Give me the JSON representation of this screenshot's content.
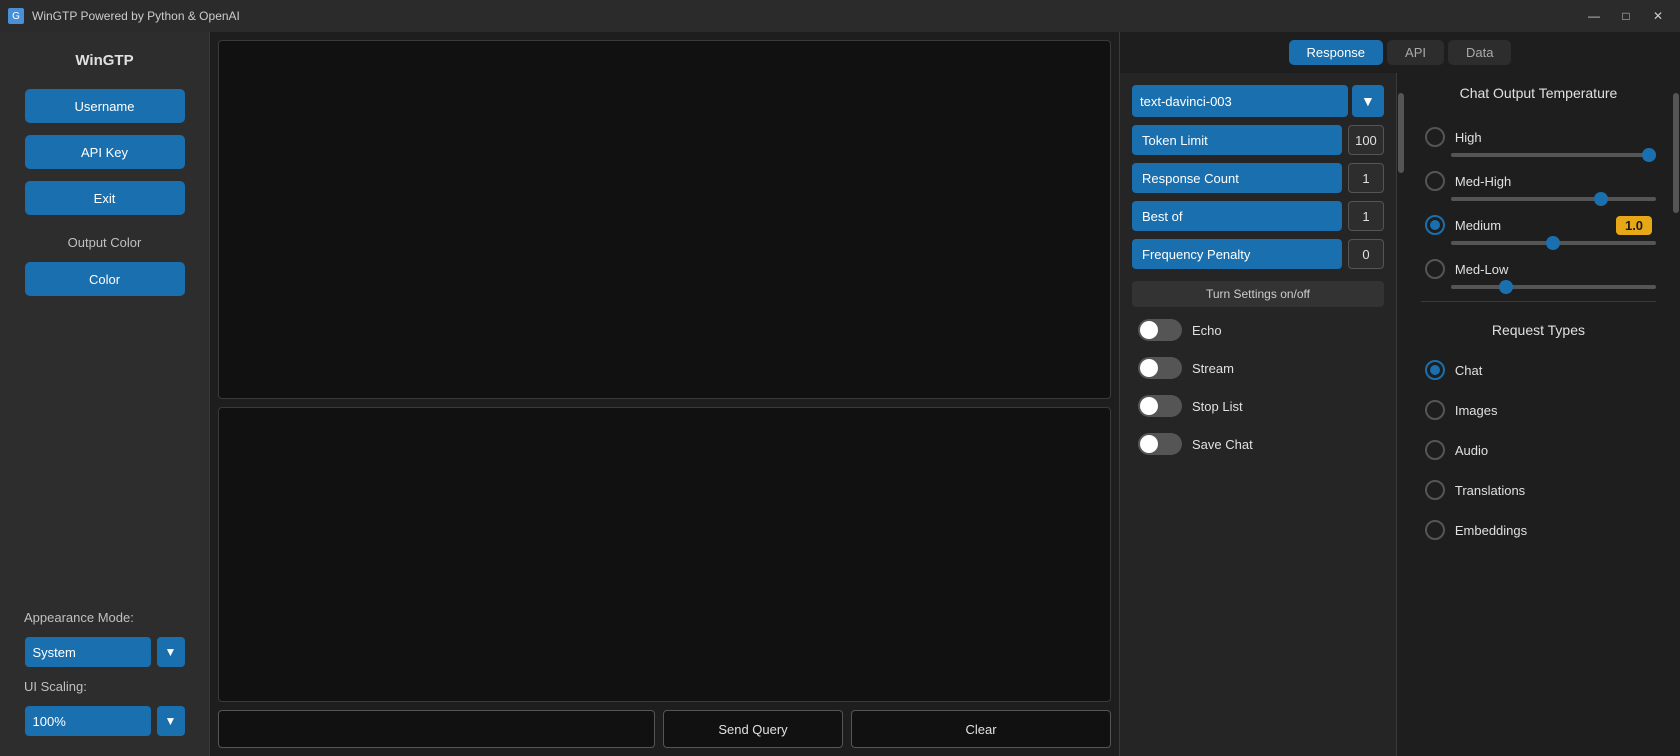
{
  "titlebar": {
    "title": "WinGTP Powered by Python & OpenAI",
    "icon": "G",
    "minimize": "—",
    "maximize": "□",
    "close": "✕"
  },
  "sidebar": {
    "app_name": "WinGTP",
    "username_btn": "Username",
    "api_key_btn": "API Key",
    "exit_btn": "Exit",
    "output_color_label": "Output Color",
    "color_btn": "Color",
    "appearance_label": "Appearance Mode:",
    "appearance_value": "System",
    "ui_scaling_label": "UI Scaling:",
    "scaling_value": "100%"
  },
  "tabs": {
    "response": "Response",
    "api": "API",
    "data": "Data",
    "active": "response"
  },
  "settings": {
    "model": "text-davinci-003",
    "token_limit_label": "Token Limit",
    "token_limit_value": "100",
    "response_count_label": "Response Count",
    "response_count_value": "1",
    "best_of_label": "Best of",
    "best_of_value": "1",
    "frequency_penalty_label": "Frequency Penalty",
    "frequency_penalty_value": "0",
    "turn_settings_label": "Turn Settings on/off",
    "echo_label": "Echo",
    "stream_label": "Stream",
    "stop_list_label": "Stop List",
    "save_chat_label": "Save Chat"
  },
  "temperature": {
    "title": "Chat Output Temperature",
    "options": [
      {
        "label": "High",
        "value": null,
        "selected": false
      },
      {
        "label": "Med-High",
        "value": null,
        "selected": false
      },
      {
        "label": "Medium",
        "value": "1.0",
        "selected": true
      },
      {
        "label": "Med-Low",
        "value": null,
        "selected": false
      }
    ]
  },
  "request_types": {
    "title": "Request Types",
    "options": [
      {
        "label": "Chat",
        "selected": true
      },
      {
        "label": "Images",
        "selected": false
      },
      {
        "label": "Audio",
        "selected": false
      },
      {
        "label": "Translations",
        "selected": false
      },
      {
        "label": "Embeddings",
        "selected": false
      }
    ]
  },
  "inputs": {
    "query_placeholder": "",
    "send_query": "Send Query",
    "clear": "Clear"
  }
}
